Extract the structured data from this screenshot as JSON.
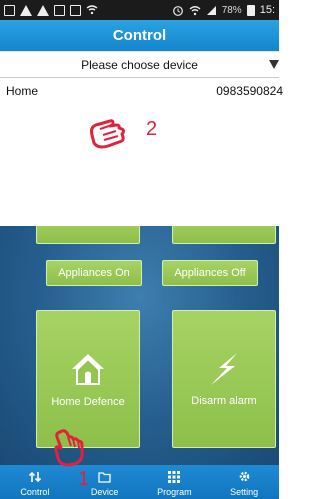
{
  "status_bar": {
    "left_icons": [
      "gallery-icon",
      "warning-icon",
      "warning-icon",
      "image-icon",
      "mail-icon",
      "wifi-icon"
    ],
    "battery_percent": "78%",
    "time": "15:"
  },
  "header": {
    "title": "Control"
  },
  "device_select": {
    "placeholder": "Please choose device"
  },
  "devices": [
    {
      "name": "Home",
      "phone": "0983590824"
    }
  ],
  "annotations": {
    "label_1": "1",
    "label_2": "2",
    "color": "#e2223b"
  },
  "panel": {
    "button_on": "Appliances On",
    "button_off": "Appliances Off",
    "tile_defence": {
      "label": "Home Defence",
      "icon": "house-icon"
    },
    "tile_disarm": {
      "label": "Disarm alarm",
      "icon": "lightning-icon"
    }
  },
  "tabs": [
    {
      "label": "Control",
      "icon": "control-icon"
    },
    {
      "label": "Device",
      "icon": "folder-icon"
    },
    {
      "label": "Program",
      "icon": "grid-icon"
    },
    {
      "label": "Setting",
      "icon": "gear-icon"
    }
  ],
  "colors": {
    "header": "#1e90d8",
    "tile": "#9bcb56",
    "panel": "#2a6597",
    "tabbar": "#1a80c8"
  }
}
